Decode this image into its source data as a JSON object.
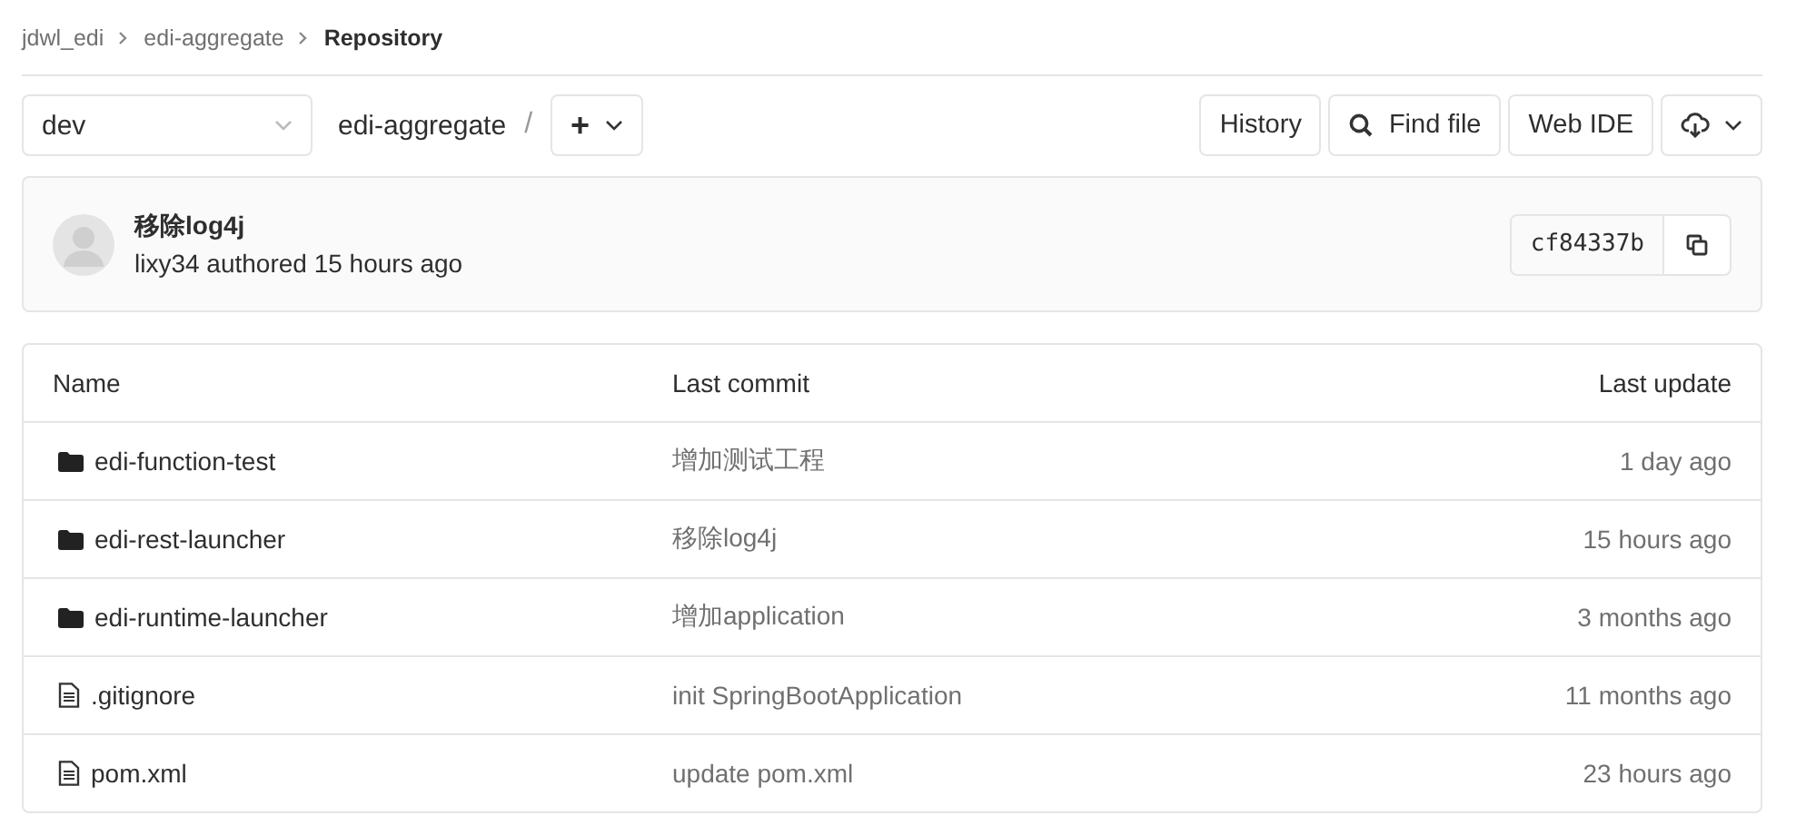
{
  "breadcrumbs": [
    {
      "label": "jdwl_edi",
      "current": false
    },
    {
      "label": "edi-aggregate",
      "current": false
    },
    {
      "label": "Repository",
      "current": true
    }
  ],
  "toolbar": {
    "branch": "dev",
    "path": "edi-aggregate",
    "separator": "/",
    "add_button": "+",
    "buttons": [
      "History",
      "Find file",
      "Web IDE"
    ]
  },
  "last_commit": {
    "message": "移除log4j",
    "author_line": "lixy34 authored 15 hours ago",
    "sha": "cf84337b"
  },
  "table": {
    "columns": [
      "Name",
      "Last commit",
      "Last update"
    ],
    "rows": [
      {
        "kind": "folder",
        "name": "edi-function-test",
        "commit": "增加测试工程",
        "updated": "1 day ago"
      },
      {
        "kind": "folder",
        "name": "edi-rest-launcher",
        "commit": "移除log4j",
        "updated": "15 hours ago"
      },
      {
        "kind": "folder",
        "name": "edi-runtime-launcher",
        "commit": "增加application",
        "updated": "3 months ago"
      },
      {
        "kind": "file",
        "name": ".gitignore",
        "commit": "init SpringBootApplication",
        "updated": "11 months ago"
      },
      {
        "kind": "file",
        "name": "pom.xml",
        "commit": "update pom.xml",
        "updated": "23 hours ago"
      }
    ]
  }
}
